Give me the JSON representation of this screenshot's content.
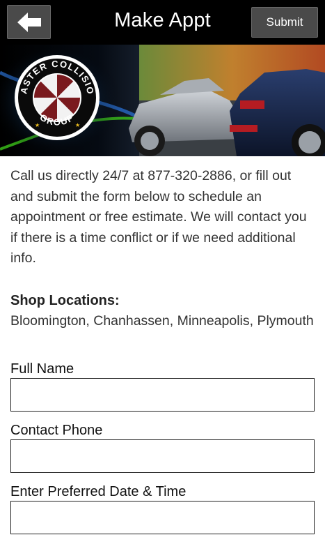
{
  "header": {
    "title": "Make Appt",
    "submit_label": "Submit",
    "back_icon": "arrow-left-icon"
  },
  "banner": {
    "logo_text_top": "MASTER COLLISION",
    "logo_text_bottom": "GROUP"
  },
  "intro": "Call us directly 24/7 at 877-320-2886, or fill out and submit the form below to schedule an appointment or free estimate. We will contact you if there is a time conflict or if we need additional info.",
  "shops": {
    "heading": "Shop Locations:",
    "list": "Bloomington, Chanhassen, Minneapolis, Plymouth"
  },
  "form": {
    "full_name_label": "Full Name",
    "full_name_value": "",
    "phone_label": "Contact Phone",
    "phone_value": "",
    "datetime_label": "Enter Preferred Date & Time",
    "datetime_value": ""
  }
}
